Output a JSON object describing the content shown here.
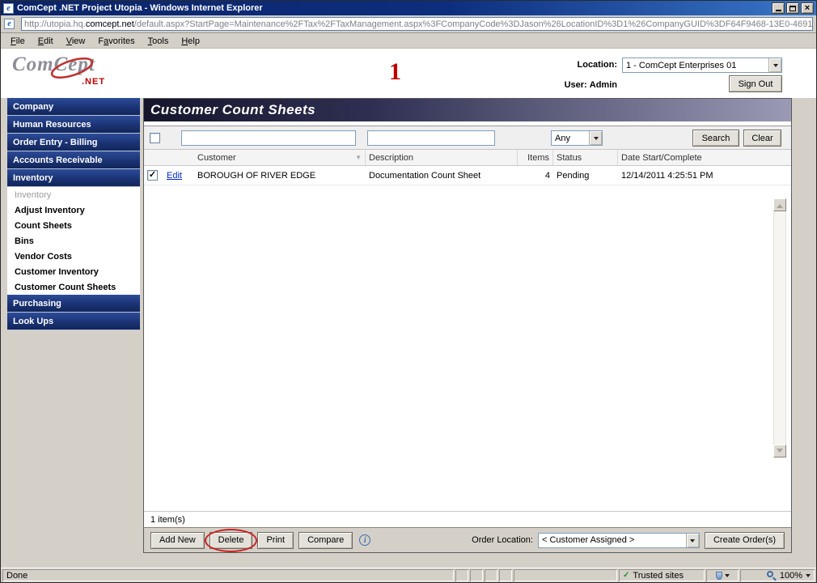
{
  "window": {
    "title": "ComCept .NET Project Utopia - Windows Internet Explorer",
    "url_pre": "http://utopia.hq.",
    "url_domain": "comcept.net",
    "url_rest": "/default.aspx?StartPage=Maintenance%2FTax%2FTaxManagement.aspx%3FCompanyCode%3DJason%26LocationID%3D1%26CompanyGUID%3DF64F9468-13E0-4691",
    "menu": [
      {
        "b": "",
        "u": "F",
        "a": "ile"
      },
      {
        "b": "",
        "u": "E",
        "a": "dit"
      },
      {
        "b": "",
        "u": "V",
        "a": "iew"
      },
      {
        "b": "F",
        "u": "a",
        "a": "vorites"
      },
      {
        "b": "",
        "u": "T",
        "a": "ools"
      },
      {
        "b": "",
        "u": "H",
        "a": "elp"
      }
    ]
  },
  "header": {
    "logo_pre": "ComC",
    "logo_e": "e",
    "logo_post": "pt",
    "logo_net": ".NET",
    "annotation": "1",
    "location_label": "Location:",
    "location_value": "1 - ComCept Enterprises 01",
    "user_label": "User:",
    "user_value": "Admin",
    "sign_out_label": "Sign Out"
  },
  "sidebar": {
    "items": [
      {
        "label": "Company"
      },
      {
        "label": "Human Resources"
      },
      {
        "label": "Order Entry - Billing"
      },
      {
        "label": "Accounts Receivable"
      },
      {
        "label": "Inventory"
      },
      {
        "label": "Inventory"
      },
      {
        "label": "Adjust Inventory"
      },
      {
        "label": "Count Sheets"
      },
      {
        "label": "Bins"
      },
      {
        "label": "Vendor Costs"
      },
      {
        "label": "Customer Inventory"
      },
      {
        "label": "Customer Count Sheets"
      },
      {
        "label": "Purchasing"
      },
      {
        "label": "Look Ups"
      }
    ]
  },
  "main": {
    "title": "Customer Count Sheets",
    "search": {
      "customer_value": "",
      "description_value": "",
      "filter_value": "Any",
      "search_label": "Search",
      "clear_label": "Clear"
    },
    "table": {
      "columns": [
        "Customer",
        "Description",
        "Items",
        "Status",
        "Date Start/Complete"
      ],
      "rows": [
        {
          "edit_label": "Edit",
          "customer": "BOROUGH OF RIVER EDGE",
          "description": "Documentation Count Sheet",
          "items": "4",
          "status": "Pending",
          "date": "12/14/2011 4:25:51 PM"
        }
      ],
      "count_text": "1 item(s)"
    },
    "footer": {
      "add_new_label": "Add New",
      "delete_label": "Delete",
      "print_label": "Print",
      "compare_label": "Compare",
      "order_location_label": "Order Location:",
      "order_location_value": "< Customer Assigned >",
      "create_orders_label": "Create Order(s)"
    }
  },
  "statusbar": {
    "status": "Done",
    "zone": "Trusted sites",
    "zoom": "100%"
  },
  "icons": {
    "ie": "e",
    "close": "×",
    "check": "✓",
    "sort_desc": "▼",
    "info": "i"
  }
}
